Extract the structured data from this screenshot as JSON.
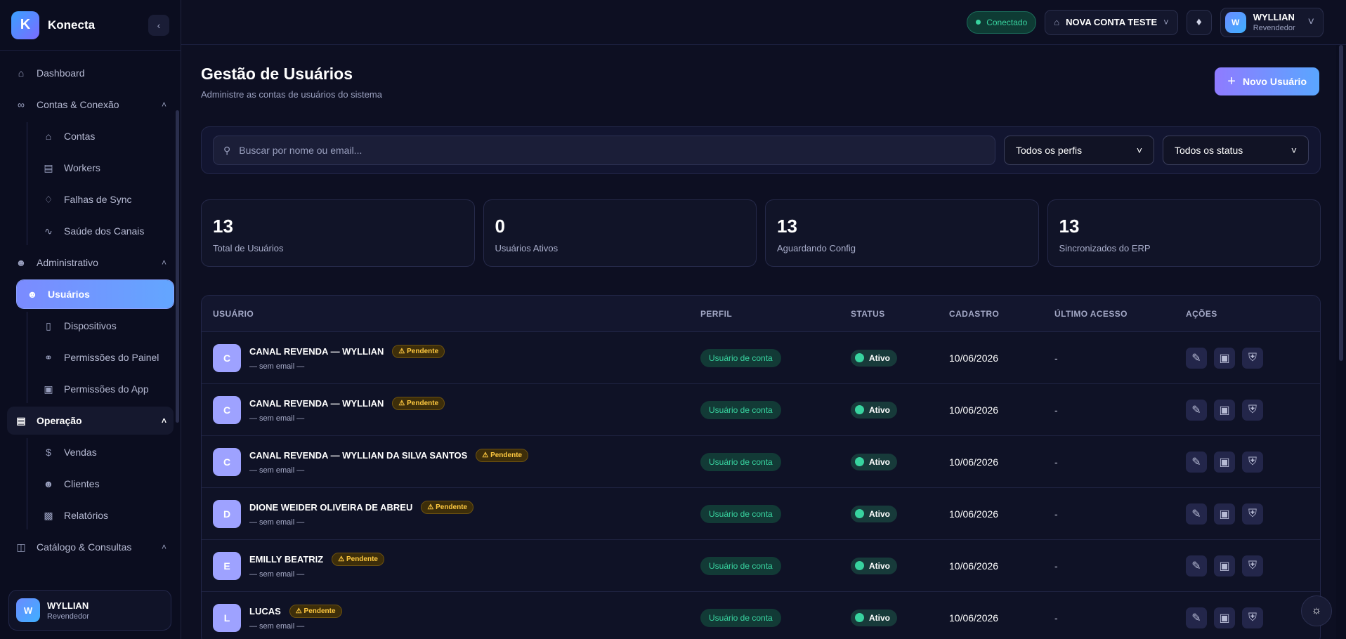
{
  "brand": {
    "name": "Konecta",
    "logo_letter": "K"
  },
  "sidebar": {
    "items": [
      {
        "label": "Dashboard",
        "icon": "home-icon"
      },
      {
        "label": "Contas & Conexão",
        "icon": "link-icon"
      },
      {
        "label": "Contas",
        "icon": "home-icon"
      },
      {
        "label": "Workers",
        "icon": "server-icon"
      },
      {
        "label": "Falhas de Sync",
        "icon": "layers-icon"
      },
      {
        "label": "Saúde dos Canais",
        "icon": "activity-icon"
      },
      {
        "label": "Administrativo",
        "icon": "users-icon"
      },
      {
        "label": "Usuários",
        "icon": "users-icon"
      },
      {
        "label": "Dispositivos",
        "icon": "smartphone-icon"
      },
      {
        "label": "Permissões do Painel",
        "icon": "key-icon"
      },
      {
        "label": "Permissões do App",
        "icon": "lock-icon"
      },
      {
        "label": "Operação",
        "icon": "clipboard-icon"
      },
      {
        "label": "Vendas",
        "icon": "dollar-icon"
      },
      {
        "label": "Clientes",
        "icon": "users-icon"
      },
      {
        "label": "Relatórios",
        "icon": "bar-chart-icon"
      },
      {
        "label": "Catálogo & Consultas",
        "icon": "database-icon"
      }
    ],
    "footer": {
      "avatar": "W",
      "name": "WYLLIAN",
      "role": "Revendedor"
    }
  },
  "topbar": {
    "status": "Conectado",
    "account": "NOVA CONTA TESTE",
    "user": {
      "avatar": "W",
      "name": "WYLLIAN",
      "role": "Revendedor"
    }
  },
  "page": {
    "title": "Gestão de Usuários",
    "subtitle": "Administre as contas de usuários do sistema",
    "new_button": "Novo Usuário"
  },
  "filters": {
    "search_placeholder": "Buscar por nome ou email...",
    "perfil": "Todos os perfis",
    "status": "Todos os status"
  },
  "stats": [
    {
      "value": "13",
      "label": "Total de Usuários"
    },
    {
      "value": "0",
      "label": "Usuários Ativos"
    },
    {
      "value": "13",
      "label": "Aguardando Config"
    },
    {
      "value": "13",
      "label": "Sincronizados do ERP"
    }
  ],
  "table": {
    "headers": [
      "USUÁRIO",
      "PERFIL",
      "STATUS",
      "CADASTRO",
      "ÚLTIMO ACESSO",
      "AÇÕES"
    ],
    "rows": [
      {
        "avatar": "C",
        "name": "CANAL REVENDA — WYLLIAN",
        "badge": "⚠ Pendente",
        "email": "— sem email —",
        "perfil": "Usuário de conta",
        "status": "Ativo",
        "cadastro": "10/06/2026",
        "ultimo": "-"
      },
      {
        "avatar": "C",
        "name": "CANAL REVENDA — WYLLIAN",
        "badge": "⚠ Pendente",
        "email": "— sem email —",
        "perfil": "Usuário de conta",
        "status": "Ativo",
        "cadastro": "10/06/2026",
        "ultimo": "-"
      },
      {
        "avatar": "C",
        "name": "CANAL REVENDA — WYLLIAN DA SILVA SANTOS",
        "badge": "⚠ Pendente",
        "email": "— sem email —",
        "perfil": "Usuário de conta",
        "status": "Ativo",
        "cadastro": "10/06/2026",
        "ultimo": "-"
      },
      {
        "avatar": "D",
        "name": "DIONE WEIDER OLIVEIRA DE ABREU",
        "badge": "⚠ Pendente",
        "email": "— sem email —",
        "perfil": "Usuário de conta",
        "status": "Ativo",
        "cadastro": "10/06/2026",
        "ultimo": "-"
      },
      {
        "avatar": "E",
        "name": "EMILLY BEATRIZ",
        "badge": "⚠ Pendente",
        "email": "— sem email —",
        "perfil": "Usuário de conta",
        "status": "Ativo",
        "cadastro": "10/06/2026",
        "ultimo": "-"
      },
      {
        "avatar": "L",
        "name": "LUCAS",
        "badge": "⚠ Pendente",
        "email": "— sem email —",
        "perfil": "Usuário de conta",
        "status": "Ativo",
        "cadastro": "10/06/2026",
        "ultimo": "-"
      }
    ]
  },
  "colors": {
    "accent": "#7b8bff",
    "success": "#38d39f",
    "warning": "#ffc940",
    "bg": "#0d0f22"
  }
}
